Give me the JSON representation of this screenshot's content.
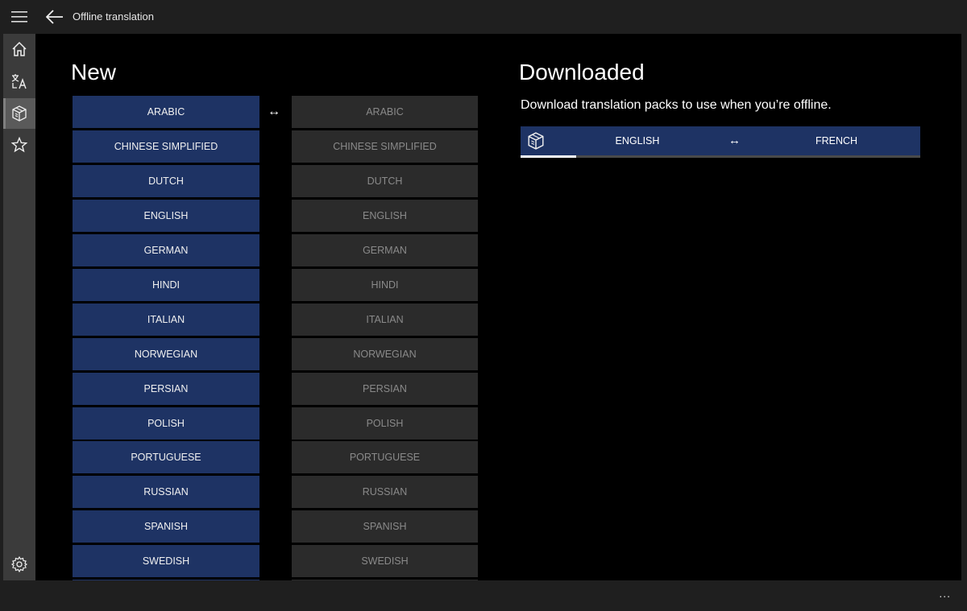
{
  "app": {
    "title": "Offline translation"
  },
  "icons": {
    "menu": "hamburger-icon",
    "back": "back-arrow-icon",
    "home": "home-icon",
    "translate": "translate-icon",
    "offline": "package-box-icon",
    "favorites": "star-icon",
    "settings": "gear-icon"
  },
  "new_section": {
    "title": "New",
    "swap_glyph": "↔",
    "languages": [
      "ARABIC",
      "CHINESE SIMPLIFIED",
      "DUTCH",
      "ENGLISH",
      "GERMAN",
      "HINDI",
      "ITALIAN",
      "NORWEGIAN",
      "PERSIAN",
      "POLISH",
      "PORTUGUESE",
      "RUSSIAN",
      "SPANISH",
      "SWEDISH"
    ],
    "target_languages": [
      "ARABIC",
      "CHINESE SIMPLIFIED",
      "DUTCH",
      "ENGLISH",
      "GERMAN",
      "HINDI",
      "ITALIAN",
      "NORWEGIAN",
      "PERSIAN",
      "POLISH",
      "PORTUGUESE",
      "RUSSIAN",
      "SPANISH",
      "SWEDISH"
    ]
  },
  "downloaded_section": {
    "title": "Downloaded",
    "description": "Download translation packs to use when you’re offline.",
    "pack": {
      "from": "ENGLISH",
      "to": "FRENCH",
      "swap_glyph": "↔",
      "progress": 0.14
    }
  },
  "bottom_bar": {
    "more_label": "..."
  },
  "colors": {
    "accent_blue": "#1e3364",
    "chrome": "#1f1f1f",
    "sidebar": "#3b3b3b",
    "target_button": "#2b2b2b"
  }
}
